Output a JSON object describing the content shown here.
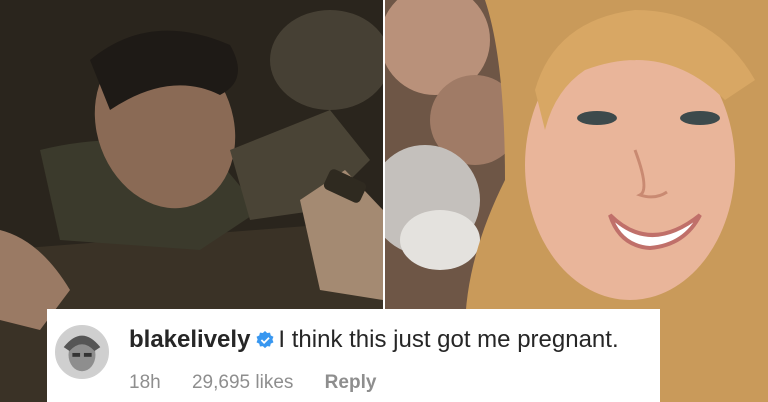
{
  "comment": {
    "username": "blakelively",
    "verified_icon": "verified-badge-icon",
    "text": "I think this just got me pregnant.",
    "time": "18h",
    "likes": "29,695 likes",
    "reply_label": "Reply"
  },
  "colors": {
    "verified_blue": "#3897f0",
    "text_primary": "#262626",
    "text_secondary": "#8e8e8e",
    "card_background": "#ffffff"
  }
}
